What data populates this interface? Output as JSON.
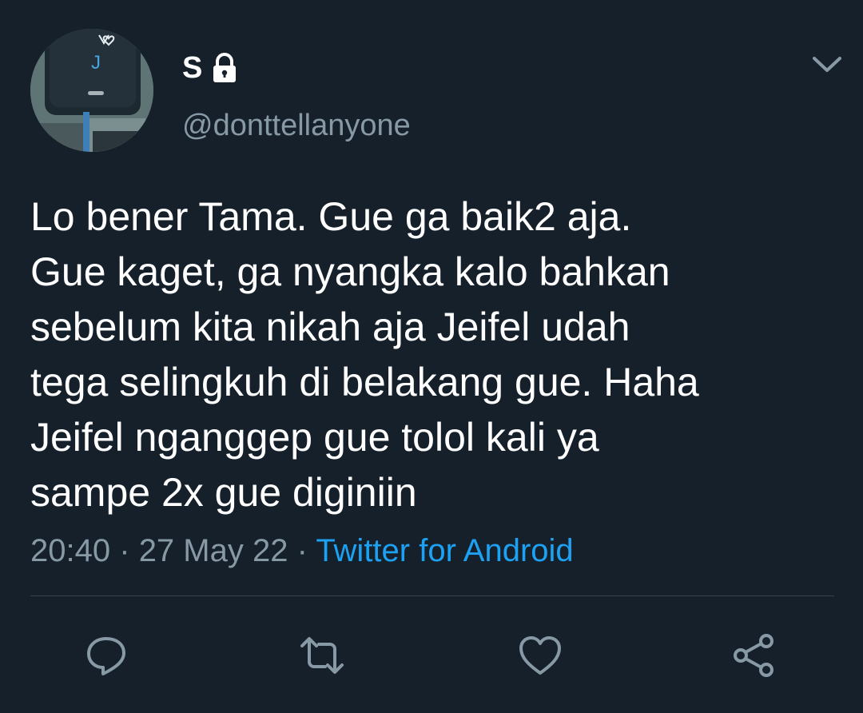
{
  "author": {
    "display_name": "S",
    "handle": "@donttellanyone",
    "protected": true
  },
  "tweet": {
    "text": "Lo bener Tama. Gue ga baik2 aja.\nGue kaget, ga nyangka kalo bahkan\nsebelum kita nikah aja Jeifel udah\ntega selingkuh di belakang gue. Haha\nJeifel nganggep gue tolol kali ya\nsampe 2x gue diginiin",
    "time": "20:40",
    "separator": "·",
    "date": "27 May 22",
    "source": "Twitter for Android"
  },
  "icons": {
    "menu": "chevron-down-icon",
    "reply": "reply-icon",
    "retweet": "retweet-icon",
    "like": "heart-icon",
    "share": "share-icon",
    "lock": "lock-icon"
  },
  "colors": {
    "background": "#15202b",
    "text": "#ffffff",
    "secondary": "#8899a6",
    "accent": "#1da1f2",
    "divider": "#38444d"
  }
}
